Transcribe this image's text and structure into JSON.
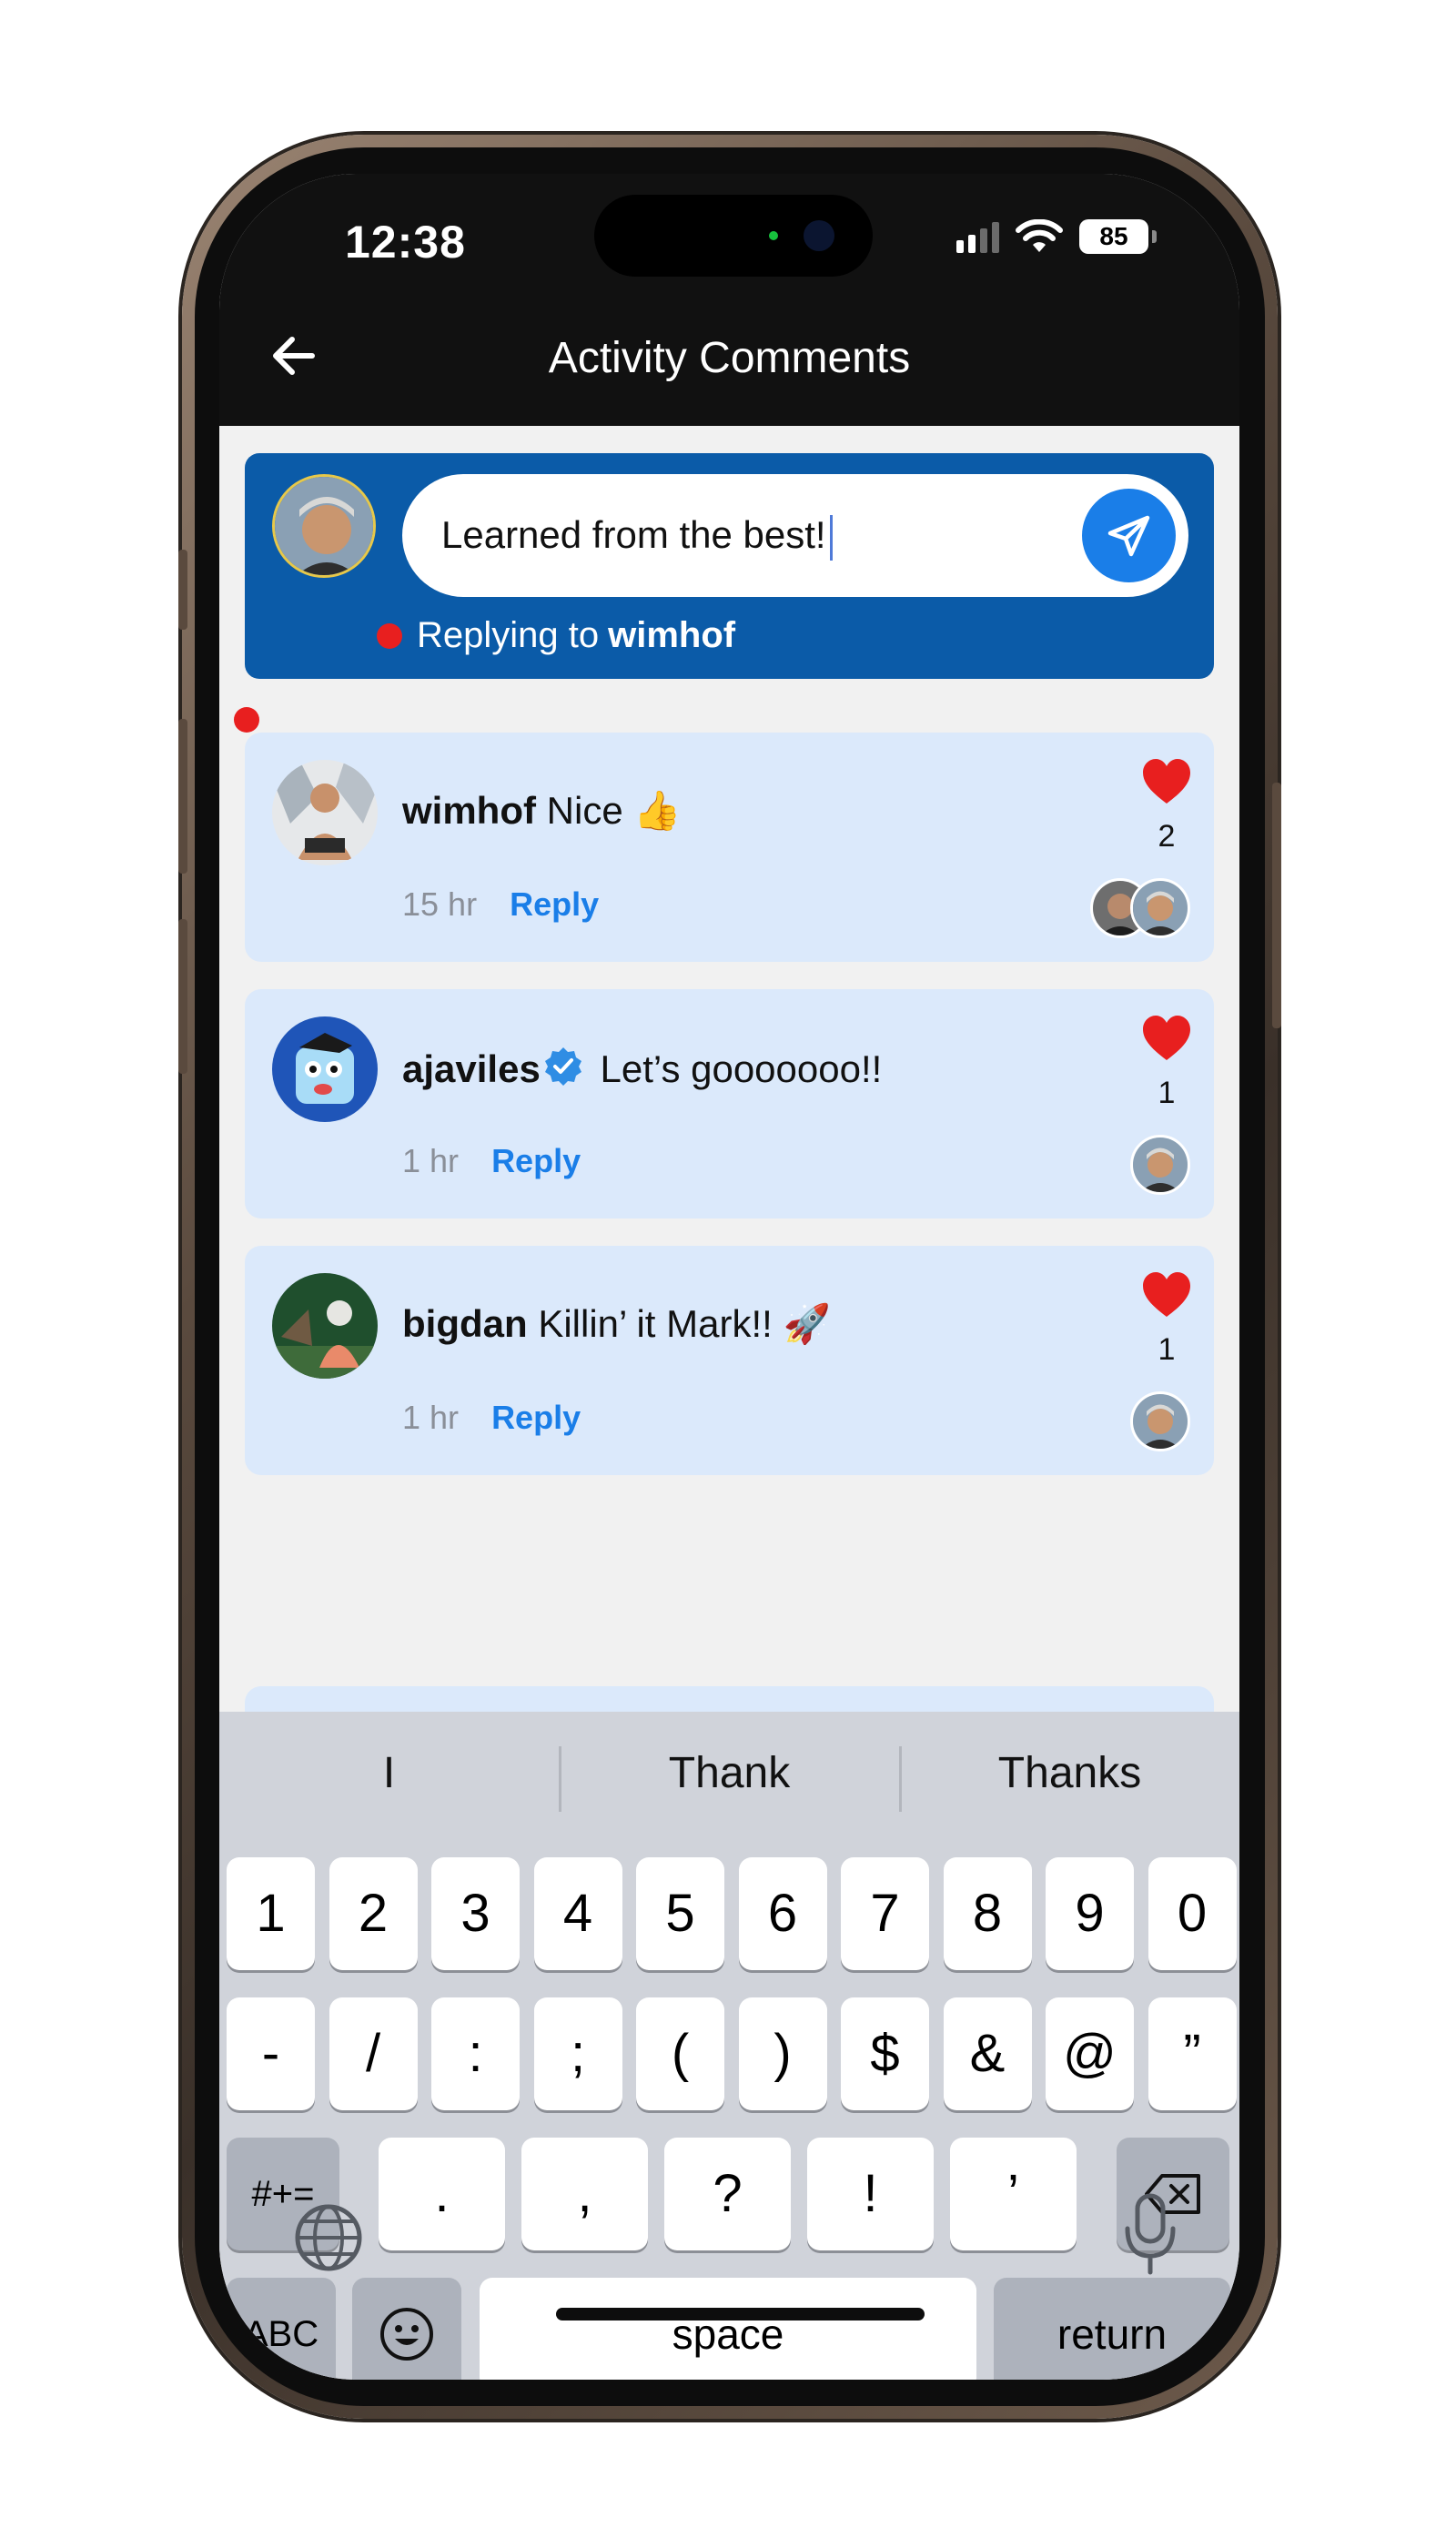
{
  "status_bar": {
    "time": "12:38",
    "battery": "85"
  },
  "header": {
    "title": "Activity Comments"
  },
  "composer": {
    "input_value": "Learned from the best!",
    "replying_prefix": "Replying to",
    "replying_user": "wimhof"
  },
  "comments": [
    {
      "username": "wimhof",
      "text": "Nice 👍",
      "time": "15 hr",
      "reply_label": "Reply",
      "likes": "2",
      "verified": false
    },
    {
      "username": "ajaviles",
      "text": "Let’s gooooooo!!",
      "time": "1 hr",
      "reply_label": "Reply",
      "likes": "1",
      "verified": true
    },
    {
      "username": "bigdan",
      "text": "Killin’ it Mark!! 🚀",
      "time": "1 hr",
      "reply_label": "Reply",
      "likes": "1",
      "verified": false
    }
  ],
  "keyboard": {
    "suggestions": [
      "I",
      "Thank",
      "Thanks"
    ],
    "row1": [
      "1",
      "2",
      "3",
      "4",
      "5",
      "6",
      "7",
      "8",
      "9",
      "0"
    ],
    "row2": [
      "-",
      "/",
      ":",
      ";",
      "(",
      ")",
      "$",
      "&",
      "@",
      "”"
    ],
    "row3": [
      ".",
      ",",
      "?",
      "!",
      "’"
    ],
    "symbols_key": "#+=",
    "abc_key": "ABC",
    "space_key": "space",
    "return_key": "return"
  },
  "colors": {
    "header_bg": "#111111",
    "composer_bg": "#0b5ba8",
    "card_bg": "#dbe9fb",
    "accent": "#1a7ee8",
    "heart": "#e81f1f"
  }
}
